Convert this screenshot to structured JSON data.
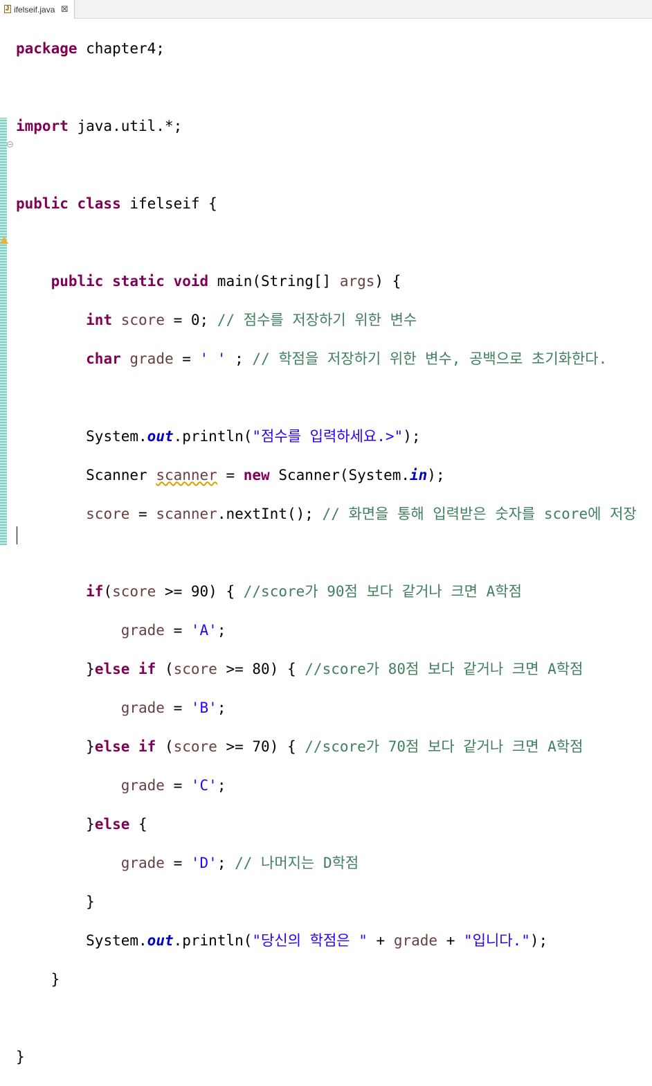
{
  "editor": {
    "tab_label": "ifelseif.java",
    "tab_close": "⊠"
  },
  "code": {
    "l1": {
      "kw": "package",
      "rest": " chapter4;"
    },
    "l3": {
      "kw": "import",
      "rest": " java.util.*;"
    },
    "l5": {
      "kw": "public class",
      "rest": " ifelseif {"
    },
    "l7": {
      "kw": "public static void",
      "rest": " main(String[] ",
      "var": "args",
      "end": ") {"
    },
    "l8": {
      "kw": "int",
      "var": "score",
      "mid": " = 0; ",
      "comment": "// 점수를 저장하기 위한 변수"
    },
    "l9": {
      "kw": "char",
      "var": "grade",
      "mid": " = ",
      "str": "' '",
      "mid2": " ; ",
      "comment": "// 학점을 저장하기 위한 변수, 공백으로 초기화한다."
    },
    "l11": {
      "pre": "System.",
      "field": "out",
      "mid": ".println(",
      "str": "\"점수를 입력하세요.>\"",
      "end": ");"
    },
    "l12": {
      "pre": "Scanner ",
      "var": "scanner",
      "mid": " = ",
      "kw": "new",
      "mid2": " Scanner(System.",
      "field": "in",
      "end": ");"
    },
    "l13": {
      "var": "score",
      "mid": " = ",
      "var2": "scanner",
      "mid2": ".nextInt(); ",
      "comment": "// 화면을 통해 입력받은 숫자를 score에 저장"
    },
    "l15": {
      "kw": "if",
      "mid": "(",
      "var": "score",
      "mid2": " >= 90) { ",
      "comment": "//score가 90점 보다 같거나 크면 A학점"
    },
    "l16": {
      "var": "grade",
      "mid": " = ",
      "str": "'A'",
      "end": ";"
    },
    "l17": {
      "pre": "}",
      "kw": "else if",
      "mid": " (",
      "var": "score",
      "mid2": " >= 80) { ",
      "comment": "//score가 80점 보다 같거나 크면 A학점"
    },
    "l18": {
      "var": "grade",
      "mid": " = ",
      "str": "'B'",
      "end": ";"
    },
    "l19": {
      "pre": "}",
      "kw": "else if",
      "mid": " (",
      "var": "score",
      "mid2": " >= 70) { ",
      "comment": "//score가 70점 보다 같거나 크면 A학점"
    },
    "l20": {
      "var": "grade",
      "mid": " = ",
      "str": "'C'",
      "end": ";"
    },
    "l21": {
      "pre": "}",
      "kw": "else",
      "end": " {"
    },
    "l22": {
      "var": "grade",
      "mid": " = ",
      "str": "'D'",
      "mid2": "; ",
      "comment": "// 나머지는 D학점"
    },
    "l23": {
      "pre": "}"
    },
    "l24": {
      "pre": "System.",
      "field": "out",
      "mid": ".println(",
      "str": "\"당신의 학점은 \"",
      "mid2": " + ",
      "var": "grade",
      "mid3": " + ",
      "str2": "\"입니다.\"",
      "end": ");"
    },
    "l25": {
      "pre": "}"
    },
    "l27": {
      "pre": "}"
    }
  }
}
